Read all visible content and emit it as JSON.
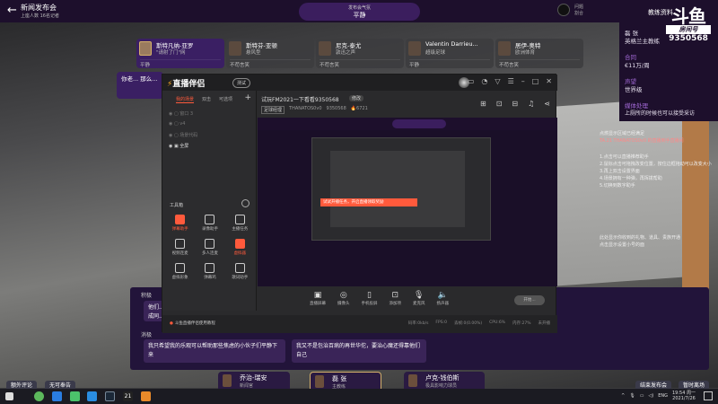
{
  "topbar": {
    "title": "新闻发布会",
    "subtitle": "上座人数 16名记者",
    "mood_label": "发布会气氛",
    "mood_value": "平静",
    "question_label": "问题",
    "question_sub": "割合",
    "coach_info": "教练资料"
  },
  "logo": {
    "text": "斗鱼",
    "tag": "房间号",
    "room": "9350568"
  },
  "coach": {
    "name": "磊 张",
    "role": "英格兰主教练",
    "contract_label": "合同",
    "contract": "€11万/周",
    "reputation_label": "声望",
    "reputation": "世界级",
    "media_label": "媒体处理",
    "media": "上厕所的时候也可以接受采访"
  },
  "reporters": [
    {
      "name": "斯特凡纳-亚罗",
      "outlet": "\"请射了门\"网",
      "mood": "平静",
      "active": true
    },
    {
      "name": "斯特芬-亚顿",
      "outlet": "悬风型",
      "mood": "不苟言笑"
    },
    {
      "name": "尼克-泰尤",
      "outlet": "敦迅之声",
      "mood": "不苟言笑"
    },
    {
      "name": "Valentin Darrieu...",
      "outlet": "超级足球",
      "mood": "平静"
    },
    {
      "name": "居伊-奥特",
      "outlet": "欧洲体育",
      "mood": "不苟言笑"
    }
  ],
  "question": "你老... 那么...",
  "app": {
    "name": "直播伴侣",
    "version": "测试",
    "tabs": [
      "我的场景",
      "双击",
      "可选项"
    ],
    "scenes": [
      "窗口 3",
      "v4",
      "场景代码",
      "全屏"
    ],
    "toolbox_label": "工具箱",
    "tools": [
      "弹幕助手",
      "录像助手",
      "主播任务",
      "视频连麦",
      "多人连麦",
      "虚拟器",
      "虚拟形象",
      "弹幕鸡",
      "歌词助手"
    ],
    "stream_title": "试玩FM2021一下看看9350568",
    "stream_tag": "修改",
    "category": "足球经理",
    "streamer": "THANATOS0v0",
    "room": "9350568",
    "heat": "6721",
    "controls": [
      "直播屏幕",
      "摄像头",
      "手机投屏",
      "添加项",
      "麦克风",
      "扬声器"
    ],
    "start_label": "开始...",
    "preview_banner": "试试开播任务，开启直播领取奖励",
    "status_left": "斗鱼直播伴侣使用教程",
    "status_right": [
      "码率:0kb/s",
      "FPS:0",
      "丢帧:0(0.00%)",
      "CPU:6%",
      "内存:27%",
      "未开播"
    ]
  },
  "chat": [
    "点燃显示区域已经满足",
    "TA.21 THANATOS0v0 的直播到手直播间",
    "1.点击可以直播推荐助手",
    "2.鼠标点击可拖拽改变位置，按住边框拖动可以改变大小",
    "3.再上双击设置界面",
    "4.场景拥有一种弹，再挥拨帮助",
    "5.切换到数字助手",
    "此处显示你收到的礼物、道具、贵族开通",
    "点击显示设置小号的面"
  ],
  "responses": {
    "positive_label": "积极",
    "positive": "他们... 成同...",
    "negative_label": "消极",
    "negative": [
      "我只希望我的乐观可以帮助那些焦虑的小伙子们平静下来",
      "我又不是包治百病的再世华佗，要治心魔还得靠他们自己"
    ]
  },
  "speakers": [
    {
      "name": "乔治-瑞安",
      "role": "新闻官"
    },
    {
      "name": "磊 张",
      "role": "主教练"
    },
    {
      "name": "卢克-钱伯斯",
      "role": "极具影响力球员"
    }
  ],
  "buttons": {
    "extra": "额外评论",
    "no_comment": "无可奉告",
    "end": "结束发布会",
    "leave": "暂时离场"
  },
  "taskbar": {
    "badge": "21",
    "lang": "ENG",
    "time": "19:54 周一",
    "date": "2021/7/26"
  }
}
